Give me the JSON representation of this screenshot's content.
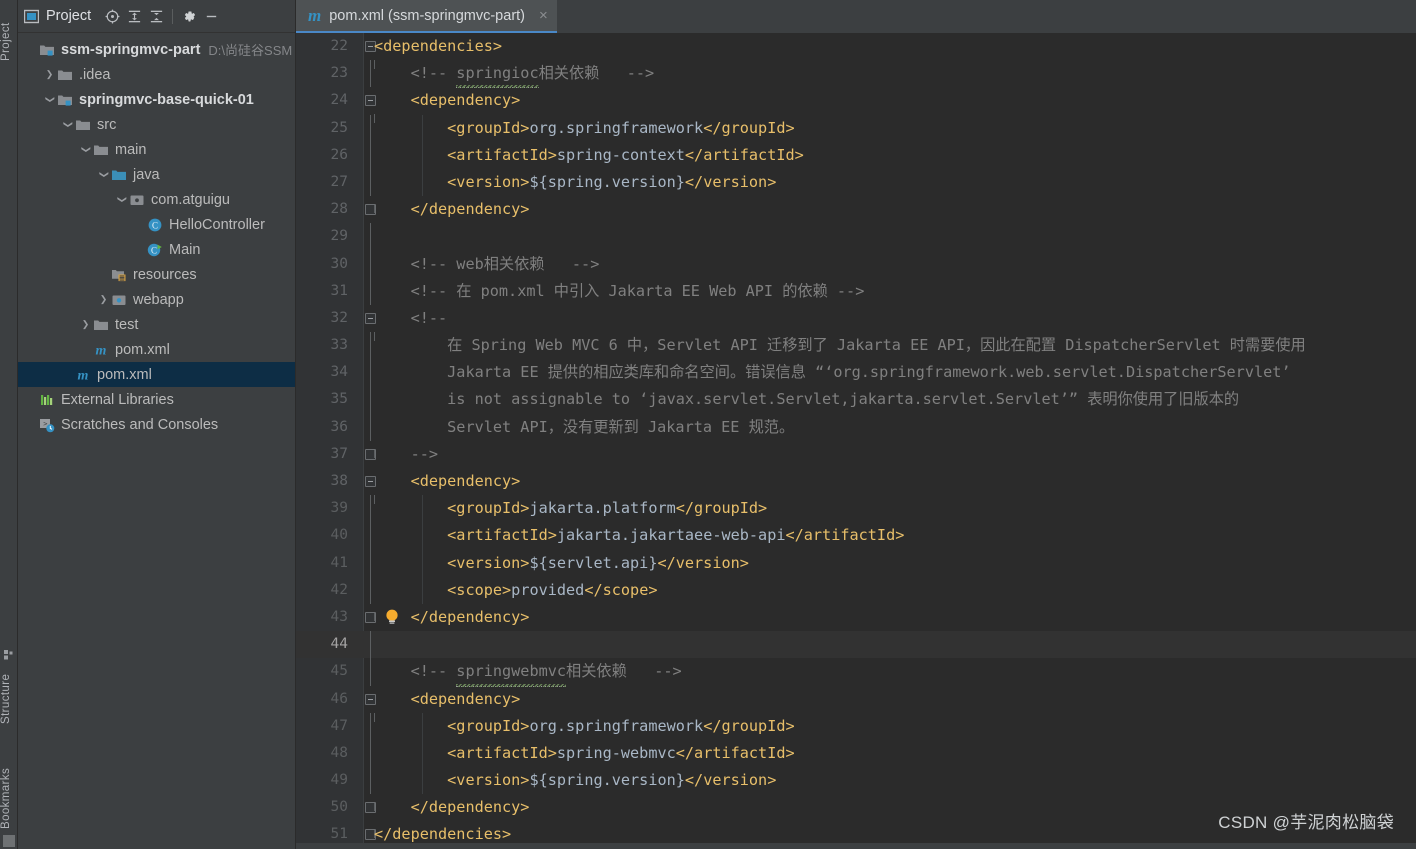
{
  "window": {
    "tool_window_title": "Project",
    "toolbar_icons": [
      "locate-icon",
      "expand-all-icon",
      "collapse-all-icon",
      "gear-icon",
      "minimize-icon"
    ]
  },
  "left_stripe": {
    "items": [
      {
        "label": "Project",
        "icon": "project-icon"
      },
      {
        "label": "Structure",
        "icon": "structure-icon"
      },
      {
        "label": "Bookmarks",
        "icon": "bookmarks-icon"
      }
    ]
  },
  "sidebar": {
    "tree": [
      {
        "label": "ssm-springmvc-part",
        "path": "D:\\尚硅谷SSM",
        "icon": "module-folder-icon",
        "indent": 0,
        "arrow": "",
        "bold": true,
        "selected": false
      },
      {
        "label": ".idea",
        "path": "",
        "icon": "folder-icon",
        "indent": 1,
        "arrow": "collapsed",
        "bold": false,
        "selected": false
      },
      {
        "label": "springmvc-base-quick-01",
        "path": "",
        "icon": "module-folder-icon",
        "indent": 1,
        "arrow": "expanded",
        "bold": true,
        "selected": false
      },
      {
        "label": "src",
        "path": "",
        "icon": "folder-icon",
        "indent": 2,
        "arrow": "expanded",
        "bold": false,
        "selected": false
      },
      {
        "label": "main",
        "path": "",
        "icon": "folder-icon",
        "indent": 3,
        "arrow": "expanded",
        "bold": false,
        "selected": false
      },
      {
        "label": "java",
        "path": "",
        "icon": "source-folder-icon",
        "indent": 4,
        "arrow": "expanded",
        "bold": false,
        "selected": false
      },
      {
        "label": "com.atguigu",
        "path": "",
        "icon": "package-icon",
        "indent": 5,
        "arrow": "expanded",
        "bold": false,
        "selected": false
      },
      {
        "label": "HelloController",
        "path": "",
        "icon": "java-class-icon",
        "indent": 6,
        "arrow": "",
        "bold": false,
        "selected": false
      },
      {
        "label": "Main",
        "path": "",
        "icon": "java-class-runnable-icon",
        "indent": 6,
        "arrow": "",
        "bold": false,
        "selected": false
      },
      {
        "label": "resources",
        "path": "",
        "icon": "resources-folder-icon",
        "indent": 4,
        "arrow": "",
        "bold": false,
        "selected": false
      },
      {
        "label": "webapp",
        "path": "",
        "icon": "webapp-folder-icon",
        "indent": 4,
        "arrow": "collapsed",
        "bold": false,
        "selected": false
      },
      {
        "label": "test",
        "path": "",
        "icon": "folder-icon",
        "indent": 3,
        "arrow": "collapsed",
        "bold": false,
        "selected": false
      },
      {
        "label": "pom.xml",
        "path": "",
        "icon": "maven-icon",
        "indent": 3,
        "arrow": "",
        "bold": false,
        "selected": false
      },
      {
        "label": "pom.xml",
        "path": "",
        "icon": "maven-icon",
        "indent": 2,
        "arrow": "",
        "bold": false,
        "selected": true
      },
      {
        "label": "External Libraries",
        "path": "",
        "icon": "external-libraries-icon",
        "indent": 0,
        "arrow": "",
        "bold": false,
        "selected": false
      },
      {
        "label": "Scratches and Consoles",
        "path": "",
        "icon": "scratches-icon",
        "indent": 0,
        "arrow": "",
        "bold": false,
        "selected": false
      }
    ]
  },
  "editor": {
    "tab": {
      "label": "pom.xml (ssm-springmvc-part)",
      "icon": "maven-icon",
      "close_label": "×"
    },
    "caret_line": 44,
    "bulb_line": 43,
    "first_line": 22,
    "lines": [
      {
        "n": 22,
        "indent": 0,
        "fold": "start",
        "html": "<span class='tg'>&lt;dependencies&gt;</span>"
      },
      {
        "n": 23,
        "indent": 0,
        "fold": "bar",
        "html": "    <span class='cm'>&lt;!-- <span class='squig typo'>springioc</span>相关依赖   --&gt;</span>"
      },
      {
        "n": 24,
        "indent": 0,
        "fold": "start",
        "html": "    <span class='tg'>&lt;dependency&gt;</span>"
      },
      {
        "n": 25,
        "indent": 1,
        "fold": "bar",
        "html": "        <span class='tg'>&lt;groupId&gt;</span><span class='txt'>org.springframework</span><span class='tg'>&lt;/groupId&gt;</span>"
      },
      {
        "n": 26,
        "indent": 1,
        "fold": "bar",
        "html": "        <span class='tg'>&lt;artifactId&gt;</span><span class='txt'>spring-context</span><span class='tg'>&lt;/artifactId&gt;</span>"
      },
      {
        "n": 27,
        "indent": 1,
        "fold": "bar",
        "html": "        <span class='tg'>&lt;version&gt;</span><span class='txt'>${spring.version}</span><span class='tg'>&lt;/version&gt;</span>"
      },
      {
        "n": 28,
        "indent": 0,
        "fold": "end",
        "html": "    <span class='tg'>&lt;/dependency&gt;</span>"
      },
      {
        "n": 29,
        "indent": 0,
        "fold": "bar",
        "html": ""
      },
      {
        "n": 30,
        "indent": 0,
        "fold": "bar",
        "html": "    <span class='cm'>&lt;!-- web相关依赖   --&gt;</span>"
      },
      {
        "n": 31,
        "indent": 0,
        "fold": "bar",
        "html": "    <span class='cm'>&lt;!-- 在 pom.xml 中引入 Jakarta EE Web API 的依赖 --&gt;</span>"
      },
      {
        "n": 32,
        "indent": 0,
        "fold": "start",
        "html": "    <span class='cm'>&lt;!--</span>"
      },
      {
        "n": 33,
        "indent": 0,
        "fold": "bar",
        "html": "        <span class='cm'>在 Spring Web MVC 6 中，Servlet API 迁移到了 Jakarta EE API，因此在配置 DispatcherServlet 时需要使用</span>"
      },
      {
        "n": 34,
        "indent": 0,
        "fold": "bar",
        "html": "        <span class='cm'>Jakarta EE 提供的相应类库和命名空间。错误信息 “‘org.springframework.web.servlet.DispatcherServlet’</span>"
      },
      {
        "n": 35,
        "indent": 0,
        "fold": "bar",
        "html": "        <span class='cm'>is not assignable to ‘javax.servlet.Servlet,jakarta.servlet.Servlet’” 表明你使用了旧版本的</span>"
      },
      {
        "n": 36,
        "indent": 0,
        "fold": "bar",
        "html": "        <span class='cm'>Servlet API，没有更新到 Jakarta EE 规范。</span>"
      },
      {
        "n": 37,
        "indent": 0,
        "fold": "end",
        "html": "    <span class='cm'>--&gt;</span>"
      },
      {
        "n": 38,
        "indent": 0,
        "fold": "start",
        "html": "    <span class='tg'>&lt;dependency&gt;</span>"
      },
      {
        "n": 39,
        "indent": 1,
        "fold": "bar",
        "html": "        <span class='tg'>&lt;groupId&gt;</span><span class='txt'>jakarta.platform</span><span class='tg'>&lt;/groupId&gt;</span>"
      },
      {
        "n": 40,
        "indent": 1,
        "fold": "bar",
        "html": "        <span class='tg'>&lt;artifactId&gt;</span><span class='txt'>jakarta.jakartaee-web-api</span><span class='tg'>&lt;/artifactId&gt;</span>"
      },
      {
        "n": 41,
        "indent": 1,
        "fold": "bar",
        "html": "        <span class='tg'>&lt;version&gt;</span><span class='txt'>${servlet.api}</span><span class='tg'>&lt;/version&gt;</span>"
      },
      {
        "n": 42,
        "indent": 1,
        "fold": "bar",
        "html": "        <span class='tg'>&lt;scope&gt;</span><span class='txt'>provided</span><span class='tg'>&lt;/scope&gt;</span>"
      },
      {
        "n": 43,
        "indent": 0,
        "fold": "end",
        "html": "    <span class='tg'>&lt;/dependency&gt;</span>"
      },
      {
        "n": 44,
        "indent": 0,
        "fold": "bar",
        "html": ""
      },
      {
        "n": 45,
        "indent": 0,
        "fold": "bar",
        "html": "    <span class='cm'>&lt;!-- <span class='squig typo'>springwebmvc</span>相关依赖   --&gt;</span>"
      },
      {
        "n": 46,
        "indent": 0,
        "fold": "start",
        "html": "    <span class='tg'>&lt;dependency&gt;</span>"
      },
      {
        "n": 47,
        "indent": 1,
        "fold": "bar",
        "html": "        <span class='tg'>&lt;groupId&gt;</span><span class='txt'>org.springframework</span><span class='tg'>&lt;/groupId&gt;</span>"
      },
      {
        "n": 48,
        "indent": 1,
        "fold": "bar",
        "html": "        <span class='tg'>&lt;artifactId&gt;</span><span class='txt'>spring-webmvc</span><span class='tg'>&lt;/artifactId&gt;</span>"
      },
      {
        "n": 49,
        "indent": 1,
        "fold": "bar",
        "html": "        <span class='tg'>&lt;version&gt;</span><span class='txt'>${spring.version}</span><span class='tg'>&lt;/version&gt;</span>"
      },
      {
        "n": 50,
        "indent": 0,
        "fold": "end",
        "html": "    <span class='tg'>&lt;/dependency&gt;</span>"
      },
      {
        "n": 51,
        "indent": 0,
        "fold": "end",
        "html": "<span class='tg'>&lt;/dependencies&gt;</span>"
      }
    ]
  },
  "watermark": "CSDN @芋泥肉松脑袋",
  "colors": {
    "editor_bg": "#2b2b2b",
    "gutter_bg": "#313335",
    "panel_bg": "#3c3f41",
    "tab_active_bg": "#4e5254",
    "tab_underline": "#4a88c7",
    "selection_bg": "#0d2d45",
    "xml_tag": "#e8bf6a",
    "xml_text": "#a9b7c6",
    "comment": "#808080",
    "line_number": "#606366",
    "maven_icon": "#3592c4",
    "bulb": "#f5ab2e"
  }
}
